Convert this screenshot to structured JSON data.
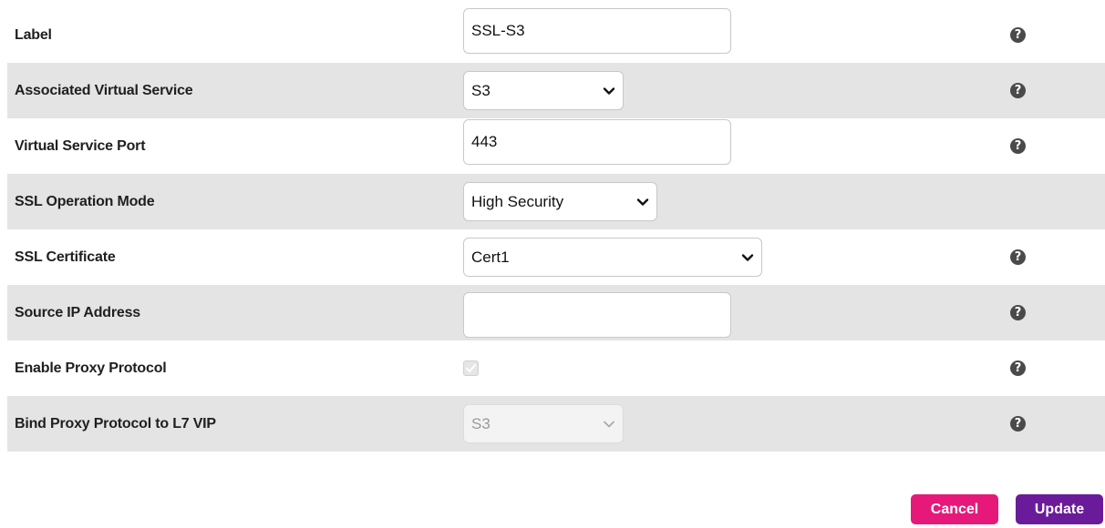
{
  "form": {
    "label": {
      "label": "Label",
      "value": "SSL-S3"
    },
    "associated_virtual_service": {
      "label": "Associated Virtual Service",
      "selected": "S3"
    },
    "virtual_service_port": {
      "label": "Virtual Service Port",
      "value": "443"
    },
    "ssl_operation_mode": {
      "label": "SSL Operation Mode",
      "selected": "High Security"
    },
    "ssl_certificate": {
      "label": "SSL Certificate",
      "selected": "Cert1"
    },
    "source_ip_address": {
      "label": "Source IP Address",
      "value": ""
    },
    "enable_proxy_protocol": {
      "label": "Enable Proxy Protocol",
      "checked": true,
      "disabled": true
    },
    "bind_proxy_protocol": {
      "label": "Bind Proxy Protocol to L7 VIP",
      "selected": "S3",
      "disabled": true
    },
    "help_icon": "question-circle"
  },
  "buttons": {
    "cancel_label": "Cancel",
    "update_label": "Update"
  },
  "colors": {
    "row_shade": "#e4e4e4",
    "cancel": "#e6197a",
    "update": "#6a1b9a",
    "help_icon": "#4a4a4a"
  }
}
